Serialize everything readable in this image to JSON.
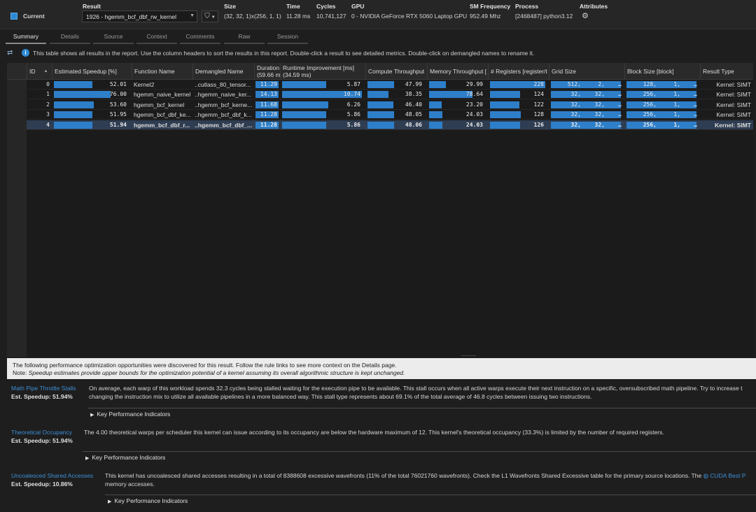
{
  "header": {
    "labels": {
      "result": "Result",
      "size": "Size",
      "time": "Time",
      "cycles": "Cycles",
      "gpu": "GPU",
      "sm_freq": "SM Frequency",
      "process": "Process",
      "attributes": "Attributes"
    },
    "current_label": "Current",
    "result_value": "1926 - hgemm_bcf_dbf_rw_kernel",
    "size": "(32, 32, 1)x(256, 1, 1)",
    "time": "11.28 ms",
    "cycles": "10,741,127",
    "gpu": "0 - NVIDIA GeForce RTX 5060 Laptop GPU",
    "sm_freq": "952.49 Mhz",
    "process": "[2468487] python3.12",
    "filter_icon": "funnel-icon",
    "attr_icon": "gear-icon",
    "colors": {
      "accent": "#2e8ad6",
      "bar": "#2e7fc9"
    }
  },
  "tabs": [
    "Summary",
    "Details",
    "Source",
    "Context",
    "Comments",
    "Raw",
    "Session"
  ],
  "info_text": "This table shows all results in the report. Use the column headers to sort the results in this report. Double-click a result to see detailed metrics. Double-click on demangled names to rename it.",
  "columns": {
    "id": "ID",
    "speedup": "Estimated Speedup [%]",
    "fname": "Function Name",
    "dname": "Demangled Name",
    "duration": "Duration",
    "duration2": "(59.66 m",
    "rt": "Runtime Improvement [ms]",
    "rt2": "(34.59 ms)",
    "compute": "Compute Throughput",
    "memory": "Memory Throughput [",
    "regs": "# Registers [register/t",
    "grid": "Grid Size",
    "block": "Block Size [block]",
    "rtype": "Result Type"
  },
  "rows": [
    {
      "id": "0",
      "speedup": "52.01",
      "sp": 0.52,
      "fname": "Kernel2",
      "dname": "..cutlass_80_tensor...",
      "dur": "11.29",
      "rt": "5.87",
      "rtf": 0.55,
      "compute": "47.99",
      "cf": 0.48,
      "memory": "29.99",
      "mf": 0.3,
      "regs": "228",
      "regf": 1.0,
      "grid": [
        "512,",
        "2,",
        "…"
      ],
      "block": [
        "128,",
        "1,",
        "…"
      ],
      "rtype": "Kernel: SIMT"
    },
    {
      "id": "1",
      "speedup": "76.00",
      "sp": 0.76,
      "fname": "hgemm_naive_kernel",
      "dname": "..hgemm_naive_ker...",
      "dur": "14.13",
      "rt": "10.74",
      "rtf": 1.0,
      "compute": "38.35",
      "cf": 0.38,
      "memory": "78.64",
      "mf": 0.79,
      "regs": "124",
      "regf": 0.54,
      "grid": [
        "32,",
        "32,",
        "…"
      ],
      "block": [
        "256,",
        "1,",
        "…"
      ],
      "rtype": "Kernel: SIMT"
    },
    {
      "id": "2",
      "speedup": "53.60",
      "sp": 0.54,
      "fname": "hgemm_bcf_kernel",
      "dname": "..hgemm_bcf_kerne...",
      "dur": "11.68",
      "rt": "6.26",
      "rtf": 0.58,
      "compute": "46.40",
      "cf": 0.46,
      "memory": "23.20",
      "mf": 0.23,
      "regs": "122",
      "regf": 0.53,
      "grid": [
        "32,",
        "32,",
        "…"
      ],
      "block": [
        "256,",
        "1,",
        "…"
      ],
      "rtype": "Kernel: SIMT"
    },
    {
      "id": "3",
      "speedup": "51.95",
      "sp": 0.52,
      "fname": "hgemm_bcf_dbf_ke...",
      "dname": "..hgemm_bcf_dbf_k...",
      "dur": "11.28",
      "rt": "5.86",
      "rtf": 0.55,
      "compute": "48.05",
      "cf": 0.48,
      "memory": "24.03",
      "mf": 0.24,
      "regs": "128",
      "regf": 0.56,
      "grid": [
        "32,",
        "32,",
        "…"
      ],
      "block": [
        "256,",
        "1,",
        "…"
      ],
      "rtype": "Kernel: SIMT"
    },
    {
      "id": "4",
      "speedup": "51.94",
      "sp": 0.52,
      "fname": "hgemm_bcf_dbf_r...",
      "dname": "..hgemm_bcf_dbf_...",
      "dur": "11.28",
      "rt": "5.86",
      "rtf": 0.55,
      "compute": "48.06",
      "cf": 0.48,
      "memory": "24.03",
      "mf": 0.24,
      "regs": "126",
      "regf": 0.55,
      "grid": [
        "32,",
        "32,",
        "…"
      ],
      "block": [
        "256,",
        "1,",
        "…"
      ],
      "rtype": "Kernel: SIMT"
    }
  ],
  "bottom": {
    "note1": "The following performance optimization opportunities were discovered for this result. Follow the rule links to see more context on the Details page.",
    "note2_prefix": "Note: ",
    "note2": "Speedup estimates provide upper bounds for the optimization potential of a kernel assuming its overall algorithmic structure is kept unchanged.",
    "rules": [
      {
        "title": "Math Pipe Throttle Stalls",
        "est": "Est. Speedup: 51.94%",
        "line1": "On average, each warp of this workload spends 32.3 cycles being stalled waiting for the execution pipe to be available. This stall occurs when all active warps execute their next instruction on a specific, oversubscribed math pipeline. Try to increase t",
        "line2": "changing the instruction mix to utilize all available pipelines in a more balanced way. This stall type represents about 69.1% of the total average of 46.8 cycles between issuing two instructions.",
        "kpi": "Key Performance Indicators"
      },
      {
        "title": "Theoretical Occupancy",
        "est": "Est. Speedup: 51.94%",
        "line1": "The 4.00 theoretical warps per scheduler this kernel can issue according to its occupancy are below the hardware maximum of 12. This kernel's theoretical occupancy (33.3%) is limited by the number of required registers.",
        "line2": "",
        "kpi": "Key Performance Indicators"
      },
      {
        "title": "Uncoalesced Shared Accesses",
        "est": "Est. Speedup: 10.86%",
        "line1": "This kernel has uncoalesced shared accesses resulting in a total of 8388608 excessive wavefronts (11% of the total 76021760 wavefronts). Check the L1 Wavefronts Shared Excessive table for the primary source locations. The ",
        "link": "CUDA Best P",
        "line2": "memory accesses.",
        "kpi": "Key Performance Indicators"
      }
    ]
  }
}
